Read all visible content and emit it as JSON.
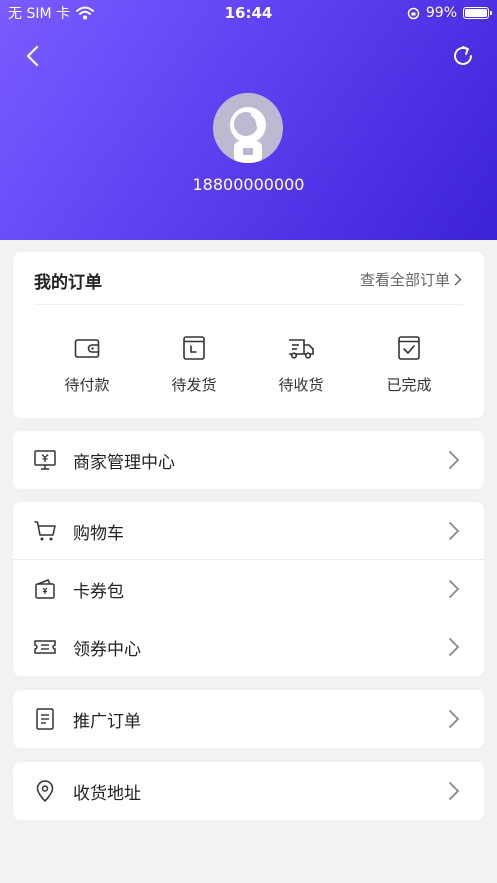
{
  "status_bar": {
    "carrier": "无 SIM 卡",
    "time": "16:44",
    "battery": "99%",
    "battery_level": 0.99
  },
  "profile": {
    "phone": "18800000000"
  },
  "orders": {
    "title": "我的订单",
    "view_all": "查看全部订单",
    "items": [
      {
        "label": "待付款",
        "icon": "wallet-icon"
      },
      {
        "label": "待发货",
        "icon": "clock-box-icon"
      },
      {
        "label": "待收货",
        "icon": "truck-icon"
      },
      {
        "label": "已完成",
        "icon": "check-box-icon"
      }
    ]
  },
  "menu": {
    "merchant": {
      "label": "商家管理中心",
      "icon": "monitor-yen-icon"
    },
    "cart": {
      "label": "购物车",
      "icon": "cart-icon"
    },
    "card_wallet": {
      "label": "卡券包",
      "icon": "coupon-bag-icon"
    },
    "coupon_center": {
      "label": "领券中心",
      "icon": "ticket-icon"
    },
    "promo_orders": {
      "label": "推广订单",
      "icon": "document-icon"
    },
    "address": {
      "label": "收货地址",
      "icon": "location-pin-icon"
    }
  },
  "colors": {
    "header_start": "#7a5cff",
    "header_end": "#3d22d6",
    "background": "#f2f2f4"
  }
}
